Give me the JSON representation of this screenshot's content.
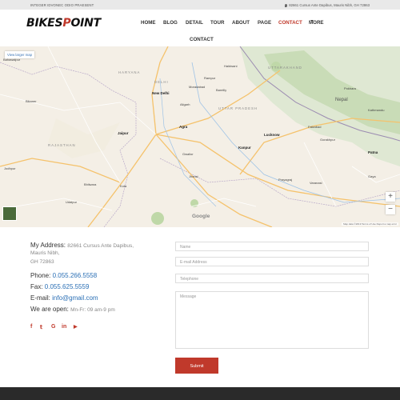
{
  "topbar": {
    "left_text": "INTEGER IDVONEC ODIO PRAESENT",
    "right_text": "82661 Cursus Ante Dapibus, Mauris Nibh, GH 72863"
  },
  "logo": {
    "part1": "BIKES",
    "part2": "P",
    "part3": "OINT"
  },
  "nav": {
    "items": [
      "HOME",
      "BLOG",
      "DETAIL",
      "TOUR",
      "ABOUT",
      "PAGE",
      "CONTACT",
      "MORE"
    ],
    "active": "CONTACT",
    "second_row": "CONTACT"
  },
  "map": {
    "view_larger": "View larger map",
    "zoom_in": "+",
    "zoom_out": "−",
    "google": "Google",
    "attribution": "Map data ©2019   Terms of Use   Report a map error",
    "labels": {
      "bahawalpur": "Bahawalpur",
      "haryana": "HARYANA",
      "delhi": "DELHI",
      "new_delhi": "New Delhi",
      "uttarakhand": "UTTARAKHAND",
      "rampur": "Rampur",
      "bareilly": "Bareilly",
      "uttar_pradesh": "UTTAR PRADESH",
      "bikaner": "Bikaner",
      "agra": "Agra",
      "jaipur": "Jaipur",
      "rajasthan": "RAJASTHAN",
      "lucknow": "Lucknow",
      "kanpur": "Kanpur",
      "nepal": "Nepal",
      "kathmandu": "Kathmandu",
      "jodhpur": "Jodhpur",
      "gwalior": "Gwalior",
      "jhansi": "Jhansi",
      "prayagraj": "Prayagraj",
      "varanasi": "Varanasi",
      "gorakhpur": "Gorakhpur",
      "bhilwara": "Bhilwara",
      "kota": "Kota",
      "udaipur": "Udaipur",
      "patna": "Patna",
      "gaya": "Gaya",
      "faizabad": "Faizabad",
      "haldwani": "Haldwani",
      "moradabad": "Moradabad",
      "aligarh": "Aligarh",
      "pokhara": "Pokhara"
    }
  },
  "contact": {
    "address_label": "My Address:",
    "address_value_1": "82661 Cursus Ante Dapibus,",
    "address_value_2": "Mauris Nibh,",
    "address_value_3": "GH 72863",
    "phone_label": "Phone:",
    "phone_value": "0.055.266.5558",
    "fax_label": "Fax:",
    "fax_value": "0.055.625.5559",
    "email_label": "E-mail:",
    "email_value": "info@gmail.com",
    "open_label": "We are open:",
    "open_value": "Mn-Fr: 09 am-9 pm"
  },
  "social": [
    {
      "icon": "facebook-icon",
      "glyph": "f"
    },
    {
      "icon": "twitter-icon",
      "glyph": "𝕥"
    },
    {
      "icon": "google-icon",
      "glyph": "G"
    },
    {
      "icon": "linkedin-icon",
      "glyph": "in"
    },
    {
      "icon": "youtube-icon",
      "glyph": "▶"
    }
  ],
  "form": {
    "name_placeholder": "Name",
    "email_placeholder": "E-mail Address",
    "phone_placeholder": "Telephone",
    "message_placeholder": "Message",
    "submit_label": "Submit"
  },
  "colors": {
    "accent": "#c0392b",
    "link": "#2a6fb5",
    "footer": "#2a2a2a"
  }
}
